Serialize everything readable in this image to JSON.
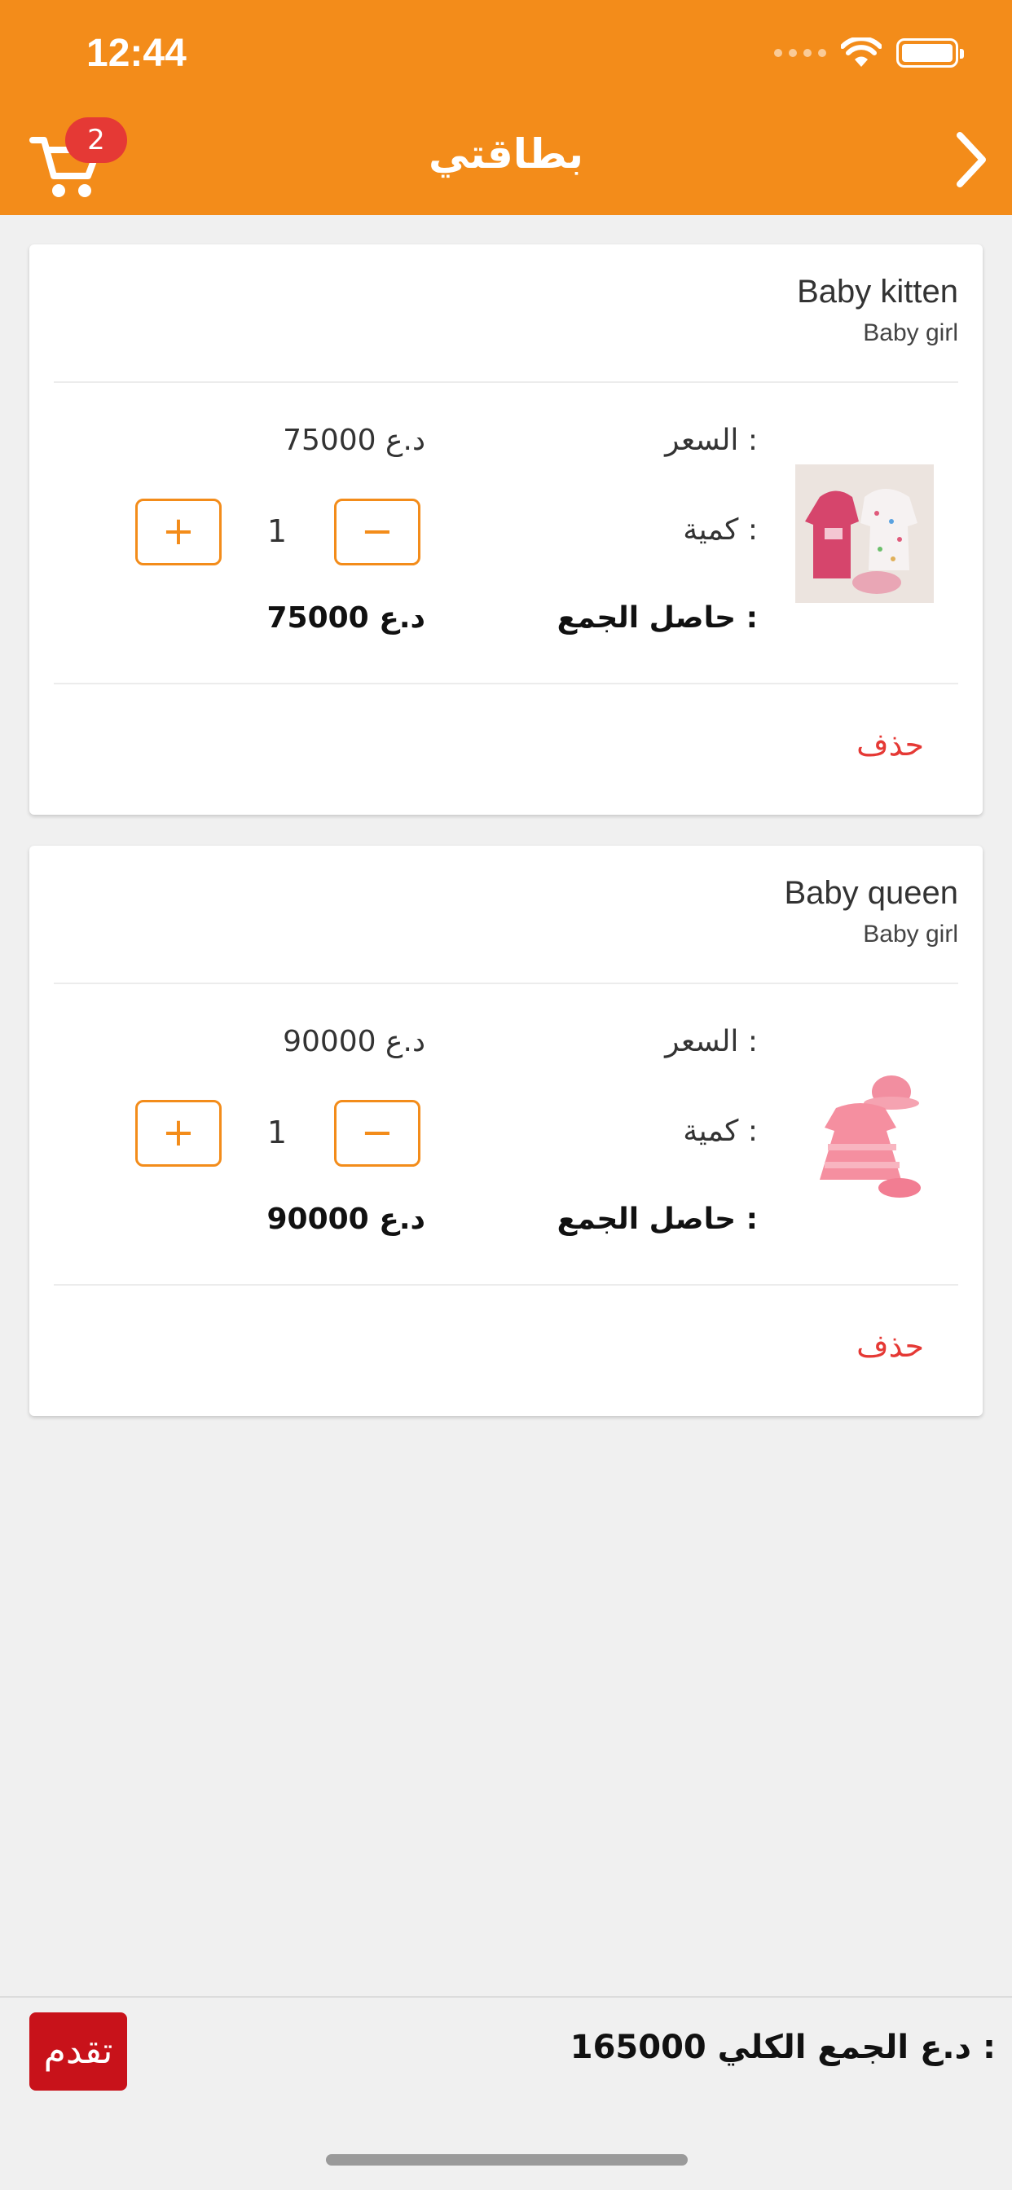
{
  "status_bar": {
    "time": "12:44"
  },
  "header": {
    "title": "بطاقتي",
    "cart_count": "2"
  },
  "cart_items": [
    {
      "name": "Baby kitten",
      "category": "Baby girl",
      "price_label": "السعر :",
      "price_value": "75000 د.ع",
      "qty_label": "كمية :",
      "qty": "1",
      "subtotal_label": "حاصل الجمع  :",
      "subtotal_value": "75000 د.ع",
      "delete_label": "حذف"
    },
    {
      "name": "Baby queen",
      "category": "Baby girl",
      "price_label": "السعر :",
      "price_value": "90000 د.ع",
      "qty_label": "كمية :",
      "qty": "1",
      "subtotal_label": "حاصل الجمع  :",
      "subtotal_value": "90000 د.ع",
      "delete_label": "حذف"
    }
  ],
  "footer": {
    "proceed_label": "تقدم",
    "total_label": "الجمع الكلي  :",
    "total_value": "165000 د.ع"
  },
  "colors": {
    "accent": "#f38c1a",
    "danger": "#e53935",
    "proceed": "#c8121a"
  }
}
